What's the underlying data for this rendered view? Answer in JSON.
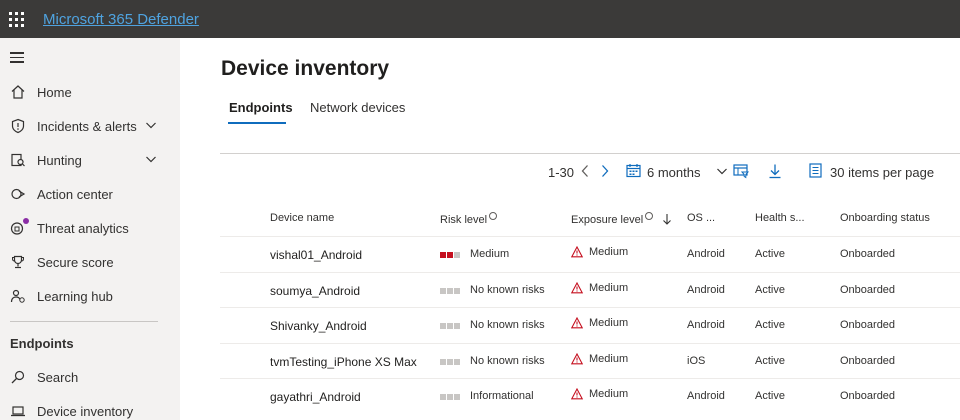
{
  "app": {
    "title": "Microsoft 365 Defender"
  },
  "sidebar": {
    "items": [
      {
        "label": "Home",
        "icon": "home-icon"
      },
      {
        "label": "Incidents & alerts",
        "icon": "shield-icon",
        "expandable": true
      },
      {
        "label": "Hunting",
        "icon": "hunting-icon",
        "expandable": true
      },
      {
        "label": "Action center",
        "icon": "action-center-icon"
      },
      {
        "label": "Threat analytics",
        "icon": "threat-analytics-icon"
      },
      {
        "label": "Secure score",
        "icon": "trophy-icon"
      },
      {
        "label": "Learning hub",
        "icon": "learning-hub-icon"
      }
    ],
    "section_title": "Endpoints",
    "section_items": [
      {
        "label": "Search",
        "icon": "search-icon"
      },
      {
        "label": "Device inventory",
        "icon": "laptop-icon"
      }
    ]
  },
  "page": {
    "title": "Device inventory",
    "tabs": [
      {
        "label": "Endpoints",
        "active": true
      },
      {
        "label": "Network devices",
        "active": false
      }
    ]
  },
  "toolbar": {
    "paging": "1-30",
    "time_range": "6 months",
    "page_size": "30 items per page"
  },
  "table": {
    "columns": [
      "Device name",
      "Risk level",
      "Exposure level",
      "OS ...",
      "Health s...",
      "Onboarding status"
    ],
    "rows": [
      {
        "device": "vishal01_Android",
        "risk": "Medium",
        "risk_bars": 2,
        "exposure": "Medium",
        "os": "Android",
        "health": "Active",
        "onboarding": "Onboarded"
      },
      {
        "device": "soumya_Android",
        "risk": "No known risks",
        "risk_bars": 0,
        "exposure": "Medium",
        "os": "Android",
        "health": "Active",
        "onboarding": "Onboarded"
      },
      {
        "device": "Shivanky_Android",
        "risk": "No known risks",
        "risk_bars": 0,
        "exposure": "Medium",
        "os": "Android",
        "health": "Active",
        "onboarding": "Onboarded"
      },
      {
        "device": "tvmTesting_iPhone XS Max",
        "risk": "No known risks",
        "risk_bars": 0,
        "exposure": "Medium",
        "os": "iOS",
        "health": "Active",
        "onboarding": "Onboarded"
      },
      {
        "device": "gayathri_Android",
        "risk": "Informational",
        "risk_bars": 0,
        "exposure": "Medium",
        "os": "Android",
        "health": "Active",
        "onboarding": "Onboarded"
      }
    ]
  },
  "colors": {
    "accent": "#0f6cbd",
    "risk_medium": "#c50f1f",
    "risk_empty": "#c8c6c4",
    "warning": "#c50f1f",
    "topbar": "#3b3a39",
    "sidebar": "#f3f2f1"
  }
}
